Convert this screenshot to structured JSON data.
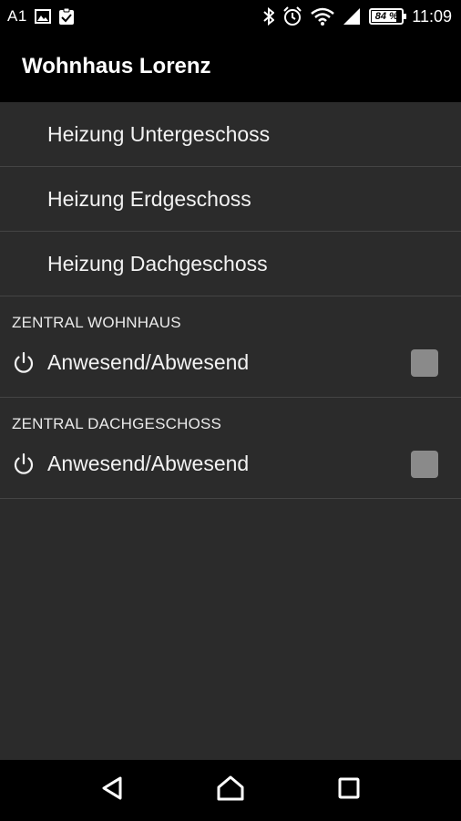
{
  "status_bar": {
    "carrier": "A1",
    "battery": "84 %",
    "time": "11:09",
    "left_icons": [
      "image-icon",
      "clipboard-check-icon"
    ],
    "right_icons": [
      "bluetooth-icon",
      "alarm-icon",
      "wifi-icon",
      "signal-icon",
      "battery-icon"
    ]
  },
  "app_bar": {
    "title": "Wohnhaus Lorenz"
  },
  "menu": {
    "items": [
      {
        "label": "Heizung Untergeschoss"
      },
      {
        "label": "Heizung Erdgeschoss"
      },
      {
        "label": "Heizung Dachgeschoss"
      }
    ]
  },
  "sections": [
    {
      "header": "ZENTRAL WOHNHAUS",
      "toggle_label": "Anwesend/Abwesend",
      "checked": false,
      "icon": "power-icon"
    },
    {
      "header": "ZENTRAL DACHGESCHOSS",
      "toggle_label": "Anwesend/Abwesend",
      "checked": false,
      "icon": "power-icon"
    }
  ],
  "nav_bar": {
    "buttons": [
      "back-icon",
      "home-icon",
      "recents-icon"
    ]
  },
  "colors": {
    "background": "#2b2b2b",
    "bar": "#000000",
    "divider": "#444444",
    "checkbox": "#8a8a8a",
    "text": "#f2f2f2"
  }
}
